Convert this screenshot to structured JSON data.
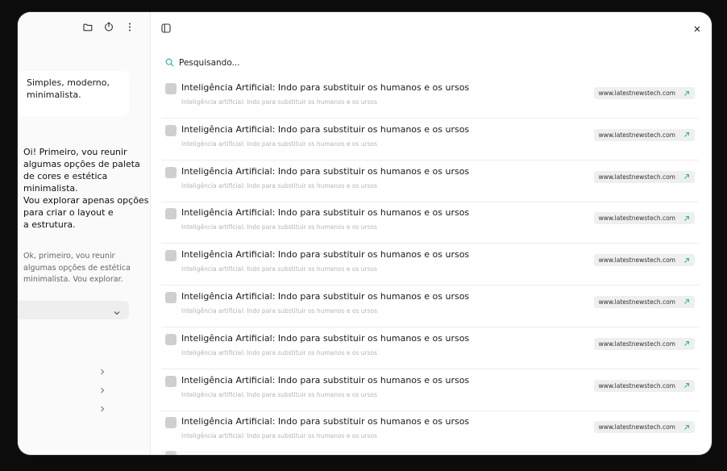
{
  "sidebar": {
    "card_text": "Simples, moderno, minimalista.",
    "assistant_message": "Oi! Primeiro, vou reunir\nalgumas opções de paleta\nde cores e estética minimalista.\nVou explorar apenas opções\npara criar o layout e\na estrutura.",
    "thinking_message": "Ok, primeiro, vou reunir\nalgumas opções de estética\nminimalista. Vou explorar.",
    "icons": [
      "folder-icon",
      "upload-icon",
      "more-vertical-icon"
    ]
  },
  "main": {
    "search_status": "Pesquisando...",
    "results": [
      {
        "title": "Inteligência Artificial: Indo para substituir os humanos e os ursos",
        "subtitle": "Inteligência artificial: Indo para substituir os humanos e os ursos",
        "url": "www.latestnewstech.com"
      },
      {
        "title": "Inteligência Artificial: Indo para substituir os humanos e os ursos",
        "subtitle": "Inteligência artificial: Indo para substituir os humanos e os ursos",
        "url": "www.latestnewstech.com"
      },
      {
        "title": "Inteligência Artificial: Indo para substituir os humanos e os ursos",
        "subtitle": "Inteligência artificial: Indo para substituir os humanos e os ursos",
        "url": "www.latestnewstech.com"
      },
      {
        "title": "Inteligência Artificial: Indo para substituir os humanos e os ursos",
        "subtitle": "Inteligência artificial: Indo para substituir os humanos e os ursos",
        "url": "www.latestnewstech.com"
      },
      {
        "title": "Inteligência Artificial: Indo para substituir os humanos e os ursos",
        "subtitle": "Inteligência artificial: Indo para substituir os humanos e os ursos",
        "url": "www.latestnewstech.com"
      },
      {
        "title": "Inteligência Artificial: Indo para substituir os humanos e os ursos",
        "subtitle": "Inteligência artificial: Indo para substituir os humanos e os ursos",
        "url": "www.latestnewstech.com"
      },
      {
        "title": "Inteligência Artificial: Indo para substituir os humanos e os ursos",
        "subtitle": "Inteligência artificial: Indo para substituir os humanos e os ursos",
        "url": "www.latestnewstech.com"
      },
      {
        "title": "Inteligência Artificial: Indo para substituir os humanos e os ursos",
        "subtitle": "Inteligência artificial: Indo para substituir os humanos e os ursos",
        "url": "www.latestnewstech.com"
      },
      {
        "title": "Inteligência Artificial: Indo para substituir os humanos e os ursos",
        "subtitle": "Inteligência artificial: Indo para substituir os humanos e os ursos",
        "url": "www.latestnewstech.com"
      }
    ]
  },
  "colors": {
    "accent": "#2bb3b3",
    "background": "#0c0c0c"
  }
}
